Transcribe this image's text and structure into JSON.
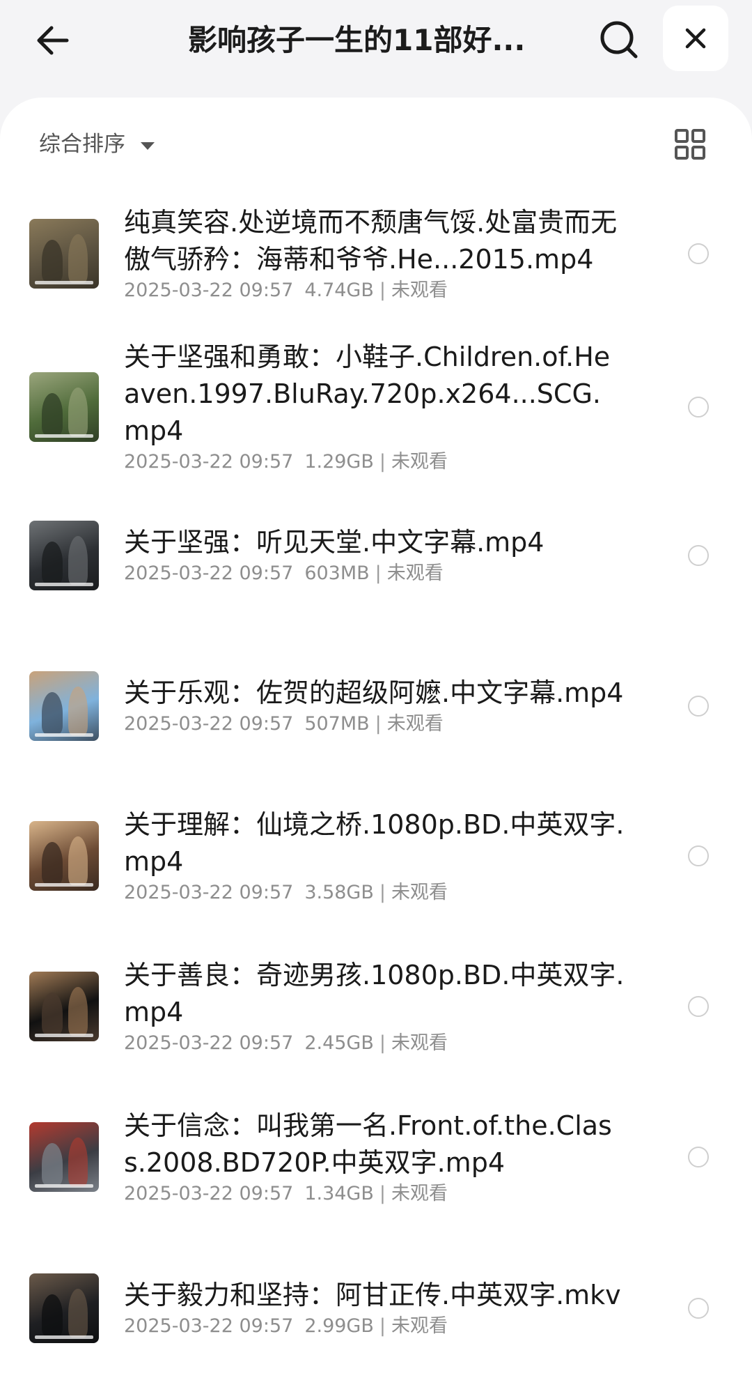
{
  "header": {
    "title": "影响孩子一生的11部好...",
    "back_icon": "arrow-left-icon",
    "search_icon": "search-icon",
    "close_icon": "close-icon"
  },
  "toolbar": {
    "sort_label": "综合排序",
    "sort_icon": "caret-down-icon",
    "view_icon": "grid-view-icon"
  },
  "files": [
    {
      "name": "纯真笑容.处逆境而不颓唐气馁.处富贵而无傲气骄矜：海蒂和爷爷.He...2015.mp4",
      "date": "2025-03-22 09:57",
      "size": "4.74GB",
      "status": "未观看",
      "thumb_colors": [
        "#5b5240",
        "#8a7a5a",
        "#3a3428"
      ]
    },
    {
      "name": "关于坚强和勇敢：小鞋子.Children.of.Heaven.1997.BluRay.720p.x264...SCG.mp4",
      "date": "2025-03-22 09:57",
      "size": "1.29GB",
      "status": "未观看",
      "thumb_colors": [
        "#4f6b3a",
        "#9aa57c",
        "#2f3f25"
      ]
    },
    {
      "name": "关于坚强：听见天堂.中文字幕.mp4",
      "date": "2025-03-22 09:57",
      "size": "603MB",
      "status": "未观看",
      "thumb_colors": [
        "#2c2f33",
        "#6e7275",
        "#1a1c1e"
      ]
    },
    {
      "name": "关于乐观：佐贺的超级阿嬷.中文字幕.mp4",
      "date": "2025-03-22 09:57",
      "size": "507MB",
      "status": "未观看",
      "thumb_colors": [
        "#7fb2dc",
        "#c9a27a",
        "#3d4f61"
      ]
    },
    {
      "name": "关于理解：仙境之桥.1080p.BD.中英双字.mp4",
      "date": "2025-03-22 09:57",
      "size": "3.58GB",
      "status": "未观看",
      "thumb_colors": [
        "#6b4a34",
        "#d8b48a",
        "#3a2a20"
      ]
    },
    {
      "name": "关于善良：奇迹男孩.1080p.BD.中英双字.mp4",
      "date": "2025-03-22 09:57",
      "size": "2.45GB",
      "status": "未观看",
      "thumb_colors": [
        "#111111",
        "#a07a55",
        "#4a3a2e"
      ]
    },
    {
      "name": "关于信念：叫我第一名.Front.of.the.Class.2008.BD720P.中英双字.mp4",
      "date": "2025-03-22 09:57",
      "size": "1.34GB",
      "status": "未观看",
      "thumb_colors": [
        "#3b3d44",
        "#b33a2f",
        "#7a8088"
      ]
    },
    {
      "name": "关于毅力和坚持：阿甘正传.中英双字.mkv",
      "date": "2025-03-22 09:57",
      "size": "2.99GB",
      "status": "未观看",
      "thumb_colors": [
        "#1e1f22",
        "#6b5a4a",
        "#0e0f10"
      ]
    }
  ]
}
